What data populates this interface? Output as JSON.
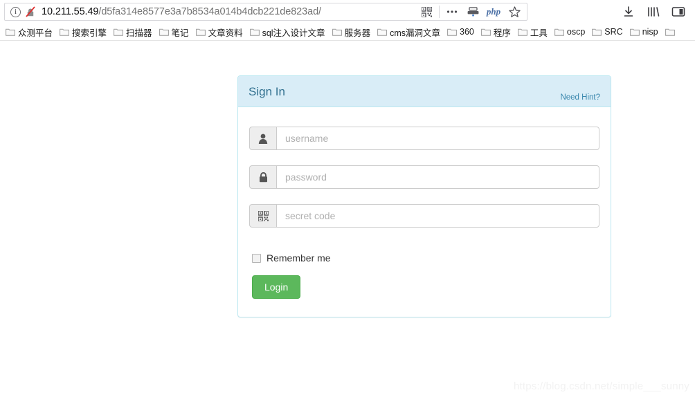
{
  "browser": {
    "url": {
      "host": "10.211.55.49",
      "path": "/d5fa314e8577e3a7b8534a014b4dcb221de823ad/",
      "full": "10.211.55.49/d5fa314e8577e3a7b8534a014b4dcb221de823ad/"
    },
    "url_icons": [
      {
        "name": "page-info-icon",
        "glyph": "i"
      },
      {
        "name": "insecure-connection-icon",
        "glyph": "crossed-lock"
      }
    ],
    "urlbar_actions": [
      {
        "name": "qr-code-icon",
        "label": ""
      },
      {
        "name": "more-actions-icon",
        "label": "..."
      },
      {
        "name": "server-icon",
        "label": ""
      },
      {
        "name": "php-icon",
        "label": "php"
      },
      {
        "name": "bookmark-star-icon",
        "label": ""
      }
    ],
    "toolbar_right": [
      {
        "name": "downloads-icon",
        "label": ""
      },
      {
        "name": "library-icon",
        "label": ""
      },
      {
        "name": "sidebar-icon",
        "label": ""
      }
    ],
    "bookmarks": [
      {
        "label": "众测平台"
      },
      {
        "label": "搜索引擎"
      },
      {
        "label": "扫描器"
      },
      {
        "label": "笔记"
      },
      {
        "label": "文章资料"
      },
      {
        "label": "sql注入设计文章"
      },
      {
        "label": "服务器"
      },
      {
        "label": "cms漏洞文章"
      },
      {
        "label": "360"
      },
      {
        "label": "程序"
      },
      {
        "label": "工具"
      },
      {
        "label": "oscp"
      },
      {
        "label": "SRC"
      },
      {
        "label": "nisp"
      }
    ]
  },
  "login_card": {
    "title": "Sign In",
    "hint_link": "Need Hint?",
    "fields": [
      {
        "name": "username",
        "icon": "user-icon",
        "placeholder": "username",
        "value": ""
      },
      {
        "name": "password",
        "icon": "lock-icon",
        "placeholder": "password",
        "value": ""
      },
      {
        "name": "secret-code",
        "icon": "qr-code-icon",
        "placeholder": "secret code",
        "value": ""
      }
    ],
    "remember_me_label": "Remember me",
    "remember_me_checked": false,
    "submit_label": "Login",
    "colors": {
      "header_bg": "#d9edf7",
      "header_border": "#bce8f1",
      "title_text": "#31708f",
      "link": "#3a87ad",
      "submit_bg": "#5cb85c",
      "submit_border": "#4cae4c"
    }
  },
  "watermark": {
    "text": "https://blog.csdn.net/simple___sunny"
  }
}
